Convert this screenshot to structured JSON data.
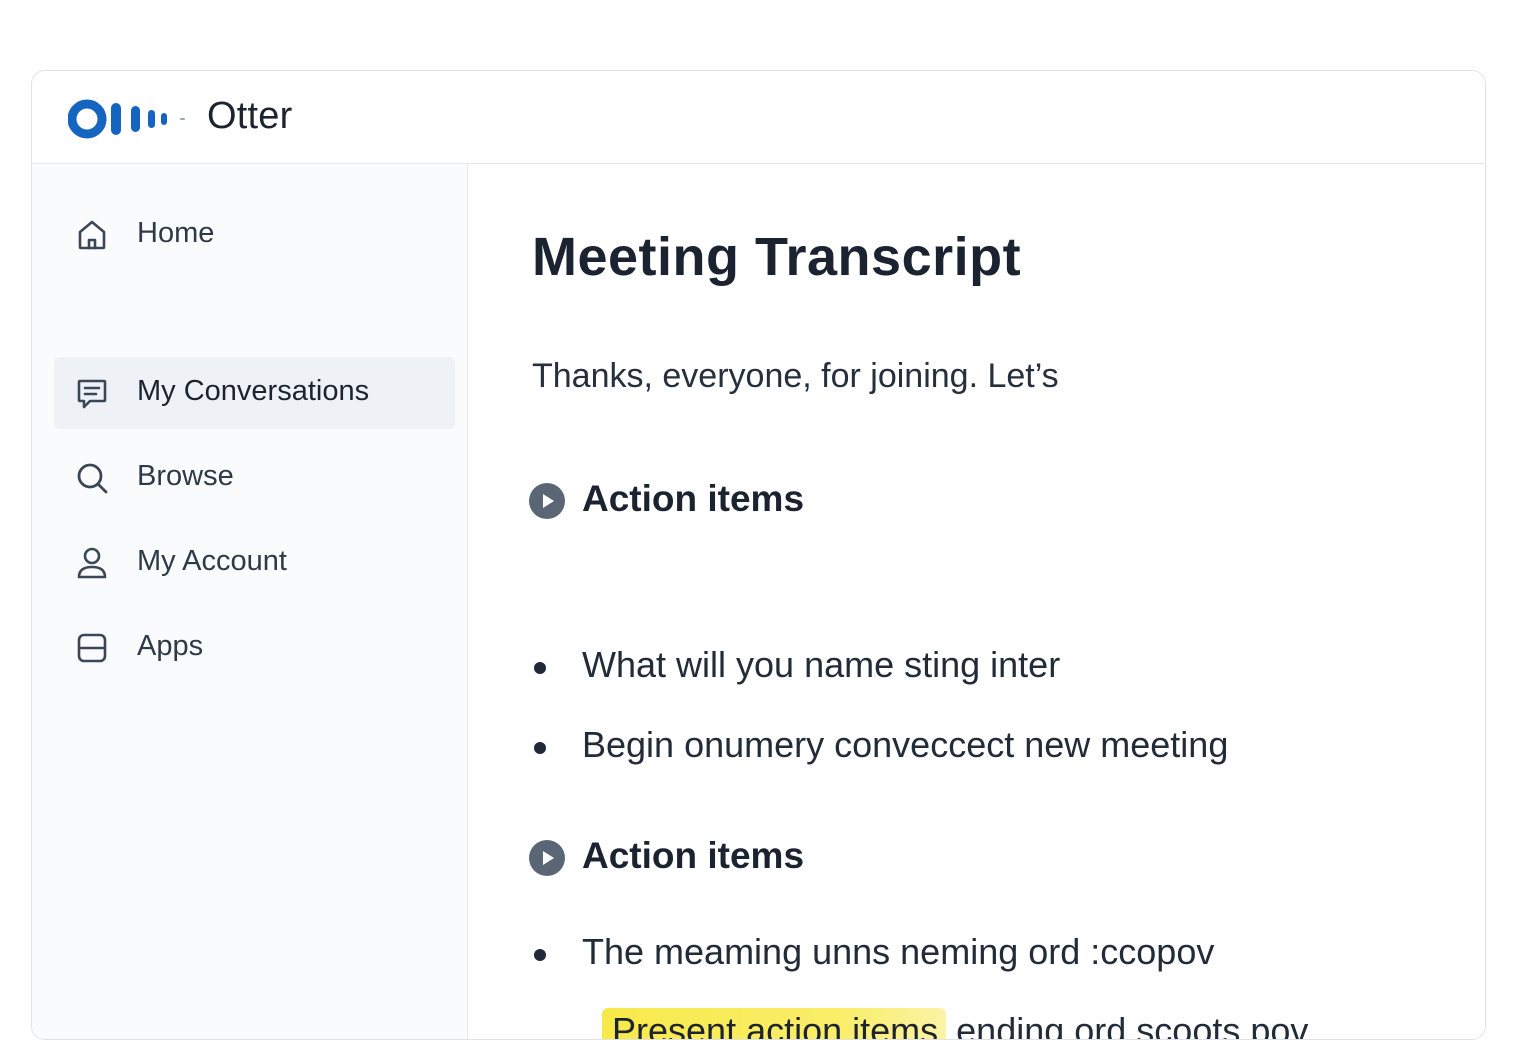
{
  "app": {
    "title": "Otter",
    "brand_color": "#1565c0"
  },
  "sidebar": {
    "items": [
      {
        "label": "Home",
        "icon": "home-icon",
        "active": false
      },
      {
        "label": "My Conversations",
        "icon": "chat-icon",
        "active": true
      },
      {
        "label": "Browse",
        "icon": "search-icon",
        "active": false
      },
      {
        "label": "My Account",
        "icon": "user-icon",
        "active": false
      },
      {
        "label": "Apps",
        "icon": "apps-icon",
        "active": false
      }
    ]
  },
  "transcript": {
    "title": "Meeting Transcript",
    "intro": "Thanks, everyone, for joining. Let’s",
    "sections": [
      {
        "heading": "Action items",
        "bullets": [
          "What will you name sting inter",
          "Begin onumery conveccect new meeting"
        ]
      },
      {
        "heading": "Action items",
        "bullets": [
          "The meaming unns neming ord :ccopov"
        ]
      }
    ],
    "last_line": {
      "highlighted": "Present action items",
      "rest": " ending ord scoots pov",
      "highlight_color": "#f8e94a"
    }
  }
}
